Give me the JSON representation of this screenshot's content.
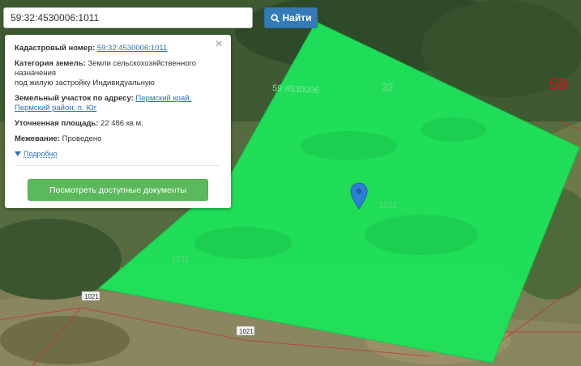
{
  "search": {
    "value": "59:32:4530006:1011",
    "button_label": "Найти"
  },
  "popup": {
    "close_glyph": "×",
    "cadastral_label": "Кадастровый номер:",
    "cadastral_value": "59:32:4530006:1011",
    "category_label": "Категория земель:",
    "category_value_line1": "Земли сельскохозяйственного",
    "category_value_line2": "назначения",
    "category_value_line3": "под жилую застройку Индивидуальную",
    "address_label": "Земельный участок по адресу:",
    "address_value_line1": "Пермский край,",
    "address_value_line2": "Пермский район, п. Юг",
    "area_label": "Уточненная площадь:",
    "area_value": "22 486 кв.м.",
    "survey_label": "Межевание:",
    "survey_value": "Проведено",
    "details_label": "Подробно",
    "docs_button_label": "Посмотреть доступные документы"
  },
  "map": {
    "region_number": "59",
    "parcel_labels": [
      "59:4530006",
      "32",
      "1011",
      "1011"
    ],
    "neighbor_labels": [
      "1021",
      "1021"
    ],
    "parcel_color": "#1ee35a",
    "boundary_color": "#c0392b",
    "marker_color": "#2f7ed8"
  }
}
